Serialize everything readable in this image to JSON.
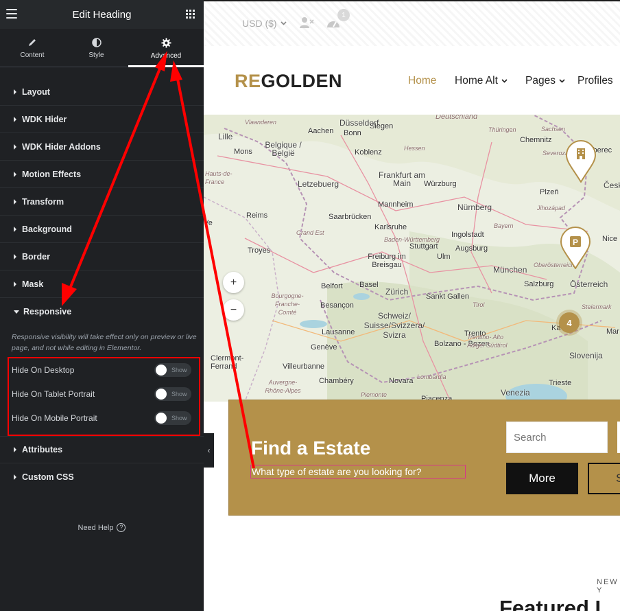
{
  "panel": {
    "title": "Edit Heading",
    "tabs": [
      {
        "label": "Content",
        "icon": "pencil-icon"
      },
      {
        "label": "Style",
        "icon": "contrast-icon"
      },
      {
        "label": "Advanced",
        "icon": "gear-icon",
        "active": true
      }
    ],
    "sections": [
      "Layout",
      "WDK Hider",
      "WDK Hider Addons",
      "Motion Effects",
      "Transform",
      "Background",
      "Border",
      "Mask",
      "Responsive",
      "Attributes",
      "Custom CSS"
    ],
    "responsive": {
      "note": "Responsive visibility will take effect only on preview or live page, and not while editing in Elementor.",
      "toggles": [
        {
          "label": "Hide On Desktop",
          "state": "Show"
        },
        {
          "label": "Hide On Tablet Portrait",
          "state": "Show"
        },
        {
          "label": "Hide On Mobile Portrait",
          "state": "Show"
        }
      ]
    },
    "help": "Need Help",
    "colors": {
      "bg": "#1f2124",
      "header": "#26292c",
      "highlight": "#ff0000"
    }
  },
  "site": {
    "currency": "USD ($)",
    "notify_count": "1",
    "logo_accent": "RE",
    "logo_rest": "GOLDEN",
    "nav": [
      "Home",
      "Home Alt",
      "Pages",
      "Profiles"
    ],
    "map": {
      "labels": [
        "Düsseldorf",
        "Aachen",
        "Bonn",
        "Siegen",
        "Lille",
        "Belgique / België",
        "Mons",
        "Koblenz",
        "Frankfurt am Main",
        "Letzebuerg",
        "Würzburg",
        "Nürnberg",
        "Mannheim",
        "Saarbrücken",
        "Reims",
        "Karlsruhe",
        "Ingolstadt",
        "Troyes",
        "Stuttgart",
        "Augsburg",
        "Freiburg im Breisgau",
        "Ulm",
        "München",
        "Belfort",
        "Basel",
        "Zürich",
        "Salzburg",
        "Österreich",
        "Besançon",
        "Sankt Gallen",
        "Schweiz/ Suisse/Svizzera/ Svizra",
        "Lausanne",
        "Genève",
        "Bolzano - Bozen",
        "Trento",
        "Slovenija",
        "Clermont-Ferrand",
        "Villeurbanne",
        "Chambéry",
        "Novara",
        "Trieste",
        "Venezia",
        "Piacenza",
        "Deutschland",
        "Chemnitz",
        "Liberec",
        "Plzeň",
        "Česk",
        "Mar",
        "Nice",
        "Sachsen",
        "Thüringen",
        "Hessen",
        "Bayern",
        "Baden-Württemberg",
        "Jihozápad",
        "Oberösterreich",
        "Steiermark",
        "Tirol",
        "Grand Est",
        "Bourgogne- Franche- Comté",
        "Auvergne- Rhône-Alpes",
        "Lombardia",
        "Piemonte",
        "Trentino- Alto Adige/ Südtirol",
        "Hauts-de- France",
        "Vlaanderen",
        "Severozá",
        "Kä",
        "Ve"
      ],
      "zoom_in": "+",
      "zoom_out": "−",
      "cluster_count": "4"
    },
    "search": {
      "title": "Find a Estate",
      "subtitle": "What type of estate are you looking for?",
      "placeholder": "Search",
      "more": "More",
      "second_btn": "S"
    },
    "new_label": "NEW Y",
    "featured": "Featured L"
  }
}
